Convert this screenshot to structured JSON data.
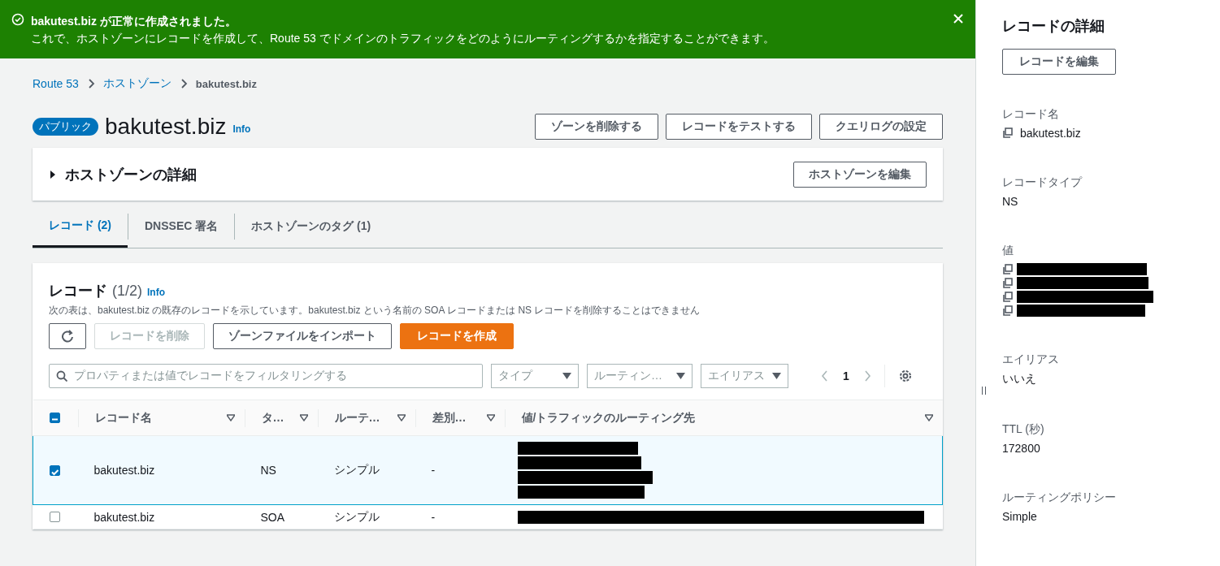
{
  "banner": {
    "title": "bakutest.biz が正常に作成されました。",
    "message": "これで、ホストゾーンにレコードを作成して、Route 53 でドメインのトラフィックをどのようにルーティングするかを指定することができます。"
  },
  "breadcrumbs": [
    "Route 53",
    "ホストゾーン",
    "bakutest.biz"
  ],
  "zone": {
    "badge": "パブリック",
    "name": "bakutest.biz",
    "info": "Info",
    "actions": [
      "ゾーンを削除する",
      "レコードをテストする",
      "クエリログの設定"
    ]
  },
  "zone_details": {
    "title": "ホストゾーンの詳細",
    "expanded": false,
    "button": "ホストゾーンを編集"
  },
  "tabs": [
    {
      "label": "レコード (2)",
      "selected": true
    },
    {
      "label": "DNSSEC 署名",
      "selected": false
    },
    {
      "label": "ホストゾーンのタグ (1)",
      "selected": false
    }
  ],
  "records": {
    "title": "レコード",
    "count": "(1/2)",
    "info": "Info",
    "description": "次の表は、bakutest.biz の既存のレコードを示しています。bakutest.biz という名前の SOA レコードまたは NS レコードを削除することはできません",
    "buttons": [
      {
        "kind": "refresh",
        "disabled": false
      },
      {
        "kind": "normal",
        "label": "レコードを削除",
        "disabled": true
      },
      {
        "kind": "normal",
        "label": "ゾーンファイルをインポート",
        "disabled": false
      },
      {
        "kind": "primary",
        "label": "レコードを作成",
        "disabled": false
      }
    ],
    "filter": {
      "placeholder": "プロパティまたは値でレコードをフィルタリングする"
    },
    "dropdowns": [
      "タイプ",
      "ルーティン…",
      "エイリアス"
    ],
    "page": "1",
    "select_all_indeterminate": true,
    "columns": [
      "レコード名",
      "タ…",
      "ルーテ…",
      "差別…",
      "値/トラフィックのルーティング先"
    ],
    "rows": [
      {
        "selected": true,
        "name": "bakutest.biz",
        "type": "NS",
        "routing": "シンプル",
        "differentiator": "-",
        "values": [
          {
            "kind": "redacted"
          },
          {
            "kind": "redacted"
          },
          {
            "kind": "redacted"
          },
          {
            "kind": "redacted"
          }
        ]
      },
      {
        "selected": false,
        "name": "bakutest.biz",
        "type": "SOA",
        "routing": "シンプル",
        "differentiator": "-",
        "values": [
          {
            "kind": "redacted"
          }
        ]
      }
    ]
  },
  "detail": {
    "title": "レコードの詳細",
    "button": "レコードを編集",
    "fields": [
      {
        "label": "レコード名",
        "kind": "copy",
        "value": "bakutest.biz"
      },
      {
        "label": "レコードタイプ",
        "kind": "text",
        "value": "NS"
      },
      {
        "label": "値",
        "kind": "redacted-list",
        "values": [
          {
            "kind": "redacted"
          },
          {
            "kind": "redacted"
          },
          {
            "kind": "redacted"
          },
          {
            "kind": "redacted"
          }
        ]
      },
      {
        "label": "エイリアス",
        "kind": "text",
        "value": "いいえ"
      },
      {
        "label": "TTL (秒)",
        "kind": "text",
        "value": "172800"
      },
      {
        "label": "ルーティングポリシー",
        "kind": "text",
        "value": "Simple"
      }
    ]
  }
}
